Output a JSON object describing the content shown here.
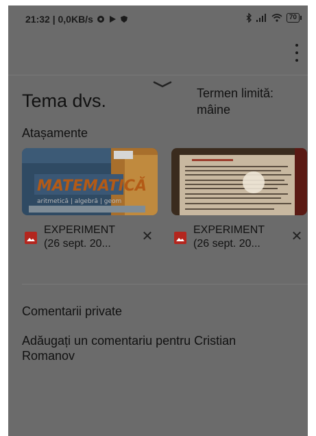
{
  "status_bar": {
    "time_speed": "21:32 | 0,0KB/s",
    "battery": "70"
  },
  "assignment": {
    "title": "Tema dvs.",
    "due_label": "Termen limită:",
    "due_value": "mâine"
  },
  "attachments": {
    "header": "Atașamente",
    "items": [
      {
        "name_line1": "EXPERIMENT",
        "name_line2": "(26 sept. 20...",
        "thumb_text": "MATEMATICĂ",
        "thumb_subtext": "aritmetică | algebră | geom"
      },
      {
        "name_line1": "EXPERIMENT",
        "name_line2": "(26 sept. 20..."
      }
    ]
  },
  "comments": {
    "header": "Comentarii private",
    "placeholder": "Adăugați un comentariu pentru Cristian Romanov"
  },
  "colors": {
    "overlay_bg": "#6b6b6b",
    "image_icon": "#b3261e"
  }
}
